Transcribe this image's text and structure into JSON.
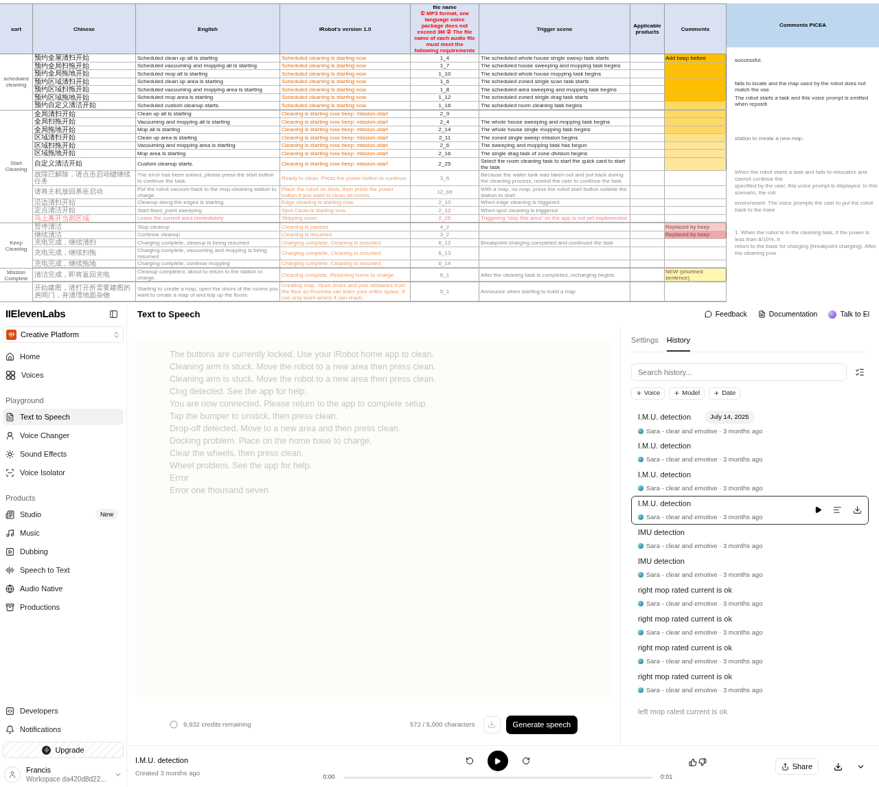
{
  "sheet": {
    "headers": [
      {
        "kind": "plain",
        "label": "sort"
      },
      {
        "kind": "plain",
        "label": "Chinese"
      },
      {
        "kind": "plain",
        "label": "English"
      },
      {
        "kind": "plain",
        "label": "iRobot's version 1.0"
      },
      {
        "kind": "note",
        "label": "file name",
        "note": "① MP3 format, one language voice package does not exceed 3M ② The file name of each audio file must meet the following requirements"
      },
      {
        "kind": "plain",
        "label": "Trigger scene"
      },
      {
        "kind": "plain",
        "label": "Applicable products"
      },
      {
        "kind": "plain",
        "label": "Comments"
      },
      {
        "kind": "plain",
        "label": "Comments PICEA"
      }
    ],
    "sections": [
      {
        "label": "scheduled cleaning",
        "rows": [
          {
            "kind": "normal",
            "zh": "预约全屋清扫开始",
            "en": "Scheduled clean up all is starting",
            "irobot": "Scheduled cleaning is starting now",
            "file": "1_4",
            "trigger": "The scheduled whole house single sweep task starts",
            "comment": "Add beep before",
            "color": "#ffc000"
          },
          {
            "kind": "normal",
            "zh": "预约全局扫拖开始",
            "en": "Scheduled vacuuming and mopping all is starting",
            "irobot": "Scheduled cleaning is starting now",
            "file": "1_7",
            "trigger": "The scheduled house sweeping and mopping task begins",
            "color": "#ffc000"
          },
          {
            "kind": "normal",
            "zh": "预约全局拖地开始",
            "en": "Scheduled mop all is starting",
            "irobot": "Scheduled cleaning is starting now",
            "file": "1_10",
            "trigger": "The scheduled whole house mopping task begins",
            "color": "#ffc000"
          },
          {
            "kind": "normal",
            "zh": "预约区域清扫开始",
            "en": "Scheduled clean up area is starting",
            "irobot": "Scheduled cleaning is starting now",
            "file": "1_6",
            "trigger": "The scheduled zoned single scan task starts",
            "color": "#ffc000"
          },
          {
            "kind": "normal",
            "zh": "预约区域扫拖开始",
            "en": "Scheduled vacuuming and mopping area is starting",
            "irobot": "Scheduled cleaning is starting now",
            "file": "1_8",
            "trigger": "The scheduled area sweeping and mopping task begins",
            "color": "#ffc000"
          },
          {
            "kind": "normal",
            "zh": "预约区域拖地开始",
            "en": "Scheduled mop area is starting",
            "irobot": "Scheduled cleaning is starting now",
            "file": "1_12",
            "trigger": "The scheduled zoned single drag task starts",
            "color": "#ffc000"
          },
          {
            "kind": "normal",
            "zh": "预约自定义清洁开始",
            "en": "Scheduled custom cleanup starts.",
            "irobot": "Scheduled cleaning is starting now",
            "file": "1_16",
            "trigger": "The scheduled room cleaning task begins",
            "color": "#ffd966"
          }
        ]
      },
      {
        "label": "Start Cleaning",
        "rows": [
          {
            "kind": "normal",
            "zh": "全局清扫开始",
            "en": "Clean up all is starting",
            "irobot": "Cleaning is starting now beep: mission-start",
            "file": "2_9",
            "color": "#ffd966"
          },
          {
            "kind": "normal",
            "zh": "全局扫拖开始",
            "en": "Vacuuming and mopping all is starting",
            "irobot": "Cleaning is starting now beep: mission-start",
            "file": "2_4",
            "trigger": "The whole house sweeping and mopping task begins",
            "color": "#ffd966"
          },
          {
            "kind": "normal",
            "zh": "全局拖地开始",
            "en": "Mop all is starting",
            "irobot": "Cleaning is starting now beep: mission-start",
            "file": "2_14",
            "trigger": "The whole house single mopping task begins",
            "color": "#ffd966"
          },
          {
            "kind": "normal",
            "zh": "区域清扫开始",
            "en": "Clean up area is starting",
            "irobot": "Cleaning is starting now beep: mission-start",
            "file": "2_11",
            "trigger": "The zoned single sweep mission begins",
            "color": "#ffe08a"
          },
          {
            "kind": "normal",
            "zh": "区域扫拖开始",
            "en": "Vacuuming and mopping area is starting",
            "irobot": "Cleaning is starting now beep: mission-start",
            "file": "2_6",
            "trigger": "The sweeping and mopping task has begun",
            "color": "#ffe599"
          },
          {
            "kind": "normal",
            "zh": "区域拖地开始",
            "en": "Mop area is starting",
            "irobot": "Cleaning is starting now beep: mission-start",
            "file": "2_16",
            "trigger": "The single drag task of zone division begins",
            "color": "#ffe599"
          },
          {
            "kind": "normal",
            "zh": "自定义清洁开始",
            "en": "Custom cleanup starts.",
            "irobot": "Cleaning is starting now beep: mission-start",
            "file": "2_25",
            "trigger": "Select the room cleaning task to start the quick card to start the task",
            "color": "#ffe599"
          },
          {
            "kind": "normal",
            "zh": "故障已解除，请点击启动键继续任务",
            "en": "The error has been solved, please press the start button to continue the task.",
            "irobot": "Ready to clean. Press the power button to continue.",
            "file": "3_6",
            "trigger": "Because the water tank was taken out and put back during the cleaning process, remind the user to continue the task"
          },
          {
            "kind": "normal",
            "zh": "请将主机放回基座启动",
            "en": "Put the robot vacuum back to the mop-cleaning station to charge.",
            "irobot": "Place the robot on dock, then press the power button if you want to clean all rooms.",
            "file": "12_69",
            "trigger": "With a map, no map, press the robot start button outside the station to start"
          },
          {
            "kind": "normal",
            "zh": "沿边清扫开始",
            "en": "Cleanup along the edges is starting",
            "irobot": "Edge cleaning is starting now.",
            "file": "2_10",
            "trigger": "When edge cleaning is triggered"
          },
          {
            "kind": "normal",
            "zh": "定点清洁开始",
            "en": "Start fixed_point sweeping",
            "irobot": "Spot Clean is starting now.",
            "file": "2_12",
            "trigger": "When spot cleaning is triggered"
          },
          {
            "kind": "alert",
            "zh": "马上离开当前区域",
            "en": "Leave the current area immediately",
            "irobot": "Skipping room",
            "file": "2_26",
            "trigger": "Triggering \"skip this area\" on the app is not yet implemented"
          }
        ]
      },
      {
        "label": "Keep Cleaning",
        "rows": [
          {
            "kind": "normal",
            "zh": "暂停清洁",
            "en": "Stop cleanup",
            "irobot": "Cleaning is paused",
            "file": "4_2",
            "comment": "Replaced by beep",
            "color": "#f8cbcb"
          },
          {
            "kind": "normal",
            "zh": "继续清洁",
            "en": "Continue cleanup",
            "irobot": "Cleaning is resumed",
            "file": "3_2",
            "comment": "Replaced by beep",
            "color": "#f4a6a6"
          },
          {
            "kind": "normal",
            "zh": "充电完成，继续清扫",
            "en": "Charging complete, cleanup is being resumed",
            "irobot": "Charging complete. Cleaning is resumed",
            "file": "6_12",
            "trigger": "Breakpoint charging completed and continued the task"
          },
          {
            "kind": "normal",
            "zh": "充电完成，继续扫拖",
            "en": "Charging complete, vacuuming and mopping is being resumed",
            "irobot": "Charging complete. Cleaning is resumed",
            "file": "6_13"
          },
          {
            "kind": "normal",
            "zh": "充电完成，继续拖地",
            "en": "Charging complete, continue mopping",
            "irobot": "Charging complete. Cleaning is resumed",
            "file": "6_14"
          }
        ]
      },
      {
        "label": "Mission Complete",
        "rows": [
          {
            "kind": "normal",
            "zh": "清洁完成，即将返回充电",
            "en": "Cleanup completed, about to return to the station to charge.",
            "irobot": "Cleaning complete. Returning home to charge.",
            "file": "6_1",
            "trigger": "After the cleaning task is completed, recharging begins",
            "comment": "NEW (shortned sentence)",
            "color": "#fff6b0"
          }
        ]
      },
      {
        "rows": [
          {
            "kind": "normal",
            "zh": "开始建图，请打开所需要建图的房间门，并清理地面杂物",
            "en": "Starting to create a map, open the doors of the rooms you want to create a map of and tidy up the floors.",
            "irobot": "Creating map. Open doors and pick obstacles from the floor so Roomba can learn your entire space. It can only learn where it can reach.",
            "file": "5_1",
            "trigger": "Announce when starting to build a map"
          }
        ]
      }
    ],
    "picea_notes": [
      "successful.",
      "fails to locate and the map used by the robot does not match the use",
      "The robot starts a task and this voice prompt is emitted when repositi",
      "station to create a new map.",
      "When the robot starts a task and fails to relocalize and cannot continue the",
      "specified by the user, this voice prompt is displayed. In this scenario, the rob",
      "environment. The voice prompts the user to put the robot back to the base",
      "1. When the robot is in the cleaning task, if the power is less than 8/10%, it",
      "return to the base for charging (breakpoint charging). After the cleaning pow"
    ]
  },
  "sidebar": {
    "logo": "IIElevenLabs",
    "workspace_switch": "Creative Platform",
    "groups": [
      {
        "items": [
          {
            "label": "Home",
            "selected": false
          },
          {
            "label": "Voices",
            "selected": false
          }
        ]
      },
      {
        "title": "Playground",
        "items": [
          {
            "label": "Text to Speech",
            "selected": true
          },
          {
            "label": "Voice Changer",
            "selected": false
          },
          {
            "label": "Sound Effects",
            "selected": false
          },
          {
            "label": "Voice Isolator",
            "selected": false
          }
        ]
      },
      {
        "title": "Products",
        "items": [
          {
            "label": "Studio",
            "selected": false,
            "badge": "New"
          },
          {
            "label": "Music",
            "selected": false
          },
          {
            "label": "Dubbing",
            "selected": false
          },
          {
            "label": "Speech to Text",
            "selected": false
          },
          {
            "label": "Audio Native",
            "selected": false
          },
          {
            "label": "Productions",
            "selected": false
          }
        ]
      }
    ],
    "bottom_items": [
      {
        "label": "Developers"
      },
      {
        "label": "Notifications"
      }
    ],
    "upgrade": "Upgrade",
    "user": {
      "name": "Francis",
      "workspace": "Workspace da420d8d22..."
    }
  },
  "header": {
    "title": "Text to Speech",
    "buttons": [
      "Feedback",
      "Documentation",
      "Talk to El"
    ]
  },
  "editor": {
    "lines": [
      "The buttons are currently locked. Use your iRobot home app to clean.",
      "Cleaning arm is stuck. Move the robot to a new area then press clean.",
      "Cleaning arm is stuck. Move the robot to a new area then press clean.",
      "Clog detected. See the app for help.",
      "You are now connected. Please return to the app to complete setup.",
      "Tap the bumper to unstick, then press clean.",
      "Drop-off detected. Move to a new area and then press clean.",
      "Docking problem. Place on the home base to charge.",
      "Clear the wheels, then press clean.",
      "Wheel problem. See the app for help.",
      "Error",
      "Error one thousand seven"
    ],
    "credits": "9,932 credits remaining",
    "characters": "572 / 5,000 characters",
    "generate": "Generate speech"
  },
  "panel": {
    "tabs": [
      {
        "label": "Settings",
        "selected": false
      },
      {
        "label": "History",
        "selected": true
      }
    ],
    "search": {
      "placeholder": "Search history..."
    },
    "filters": [
      "Voice",
      "Model",
      "Date"
    ],
    "history": [
      {
        "title": "I.M.U. detection",
        "date": "July 14, 2025",
        "meta": "Sara - clear and emotive · 3 months ago",
        "selected": false
      },
      {
        "title": "I.M.U. detection",
        "meta": "Sara - clear and emotive · 3 months ago",
        "selected": false
      },
      {
        "title": "I.M.U. detection",
        "meta": "Sara - clear and emotive · 3 months ago",
        "selected": false
      },
      {
        "title": "I.M.U. detection",
        "meta": "Sara - clear and emotive · 3 months ago",
        "selected": true
      },
      {
        "title": "IMU detection",
        "meta": "Sara - clear and emotive · 3 months ago",
        "selected": false
      },
      {
        "title": "IMU detection",
        "meta": "Sara - clear and emotive · 3 months ago",
        "selected": false
      },
      {
        "title": "right mop rated current is ok",
        "meta": "Sara - clear and emotive · 3 months ago",
        "selected": false
      },
      {
        "title": "right mop rated current is ok",
        "meta": "Sara - clear and emotive · 3 months ago",
        "selected": false
      },
      {
        "title": "right mop rated current is ok",
        "meta": "Sara - clear and emotive · 3 months ago",
        "selected": false
      },
      {
        "title": "right mop rated current is ok",
        "meta": "Sara - clear and emotive · 3 months ago",
        "selected": false
      },
      {
        "title": "left mop rated current is ok",
        "selected": false
      }
    ]
  },
  "player": {
    "title": "I.M.U. detection",
    "created": "Created 3 months ago",
    "start": "0:00",
    "end": "0:01",
    "share": "Share"
  }
}
